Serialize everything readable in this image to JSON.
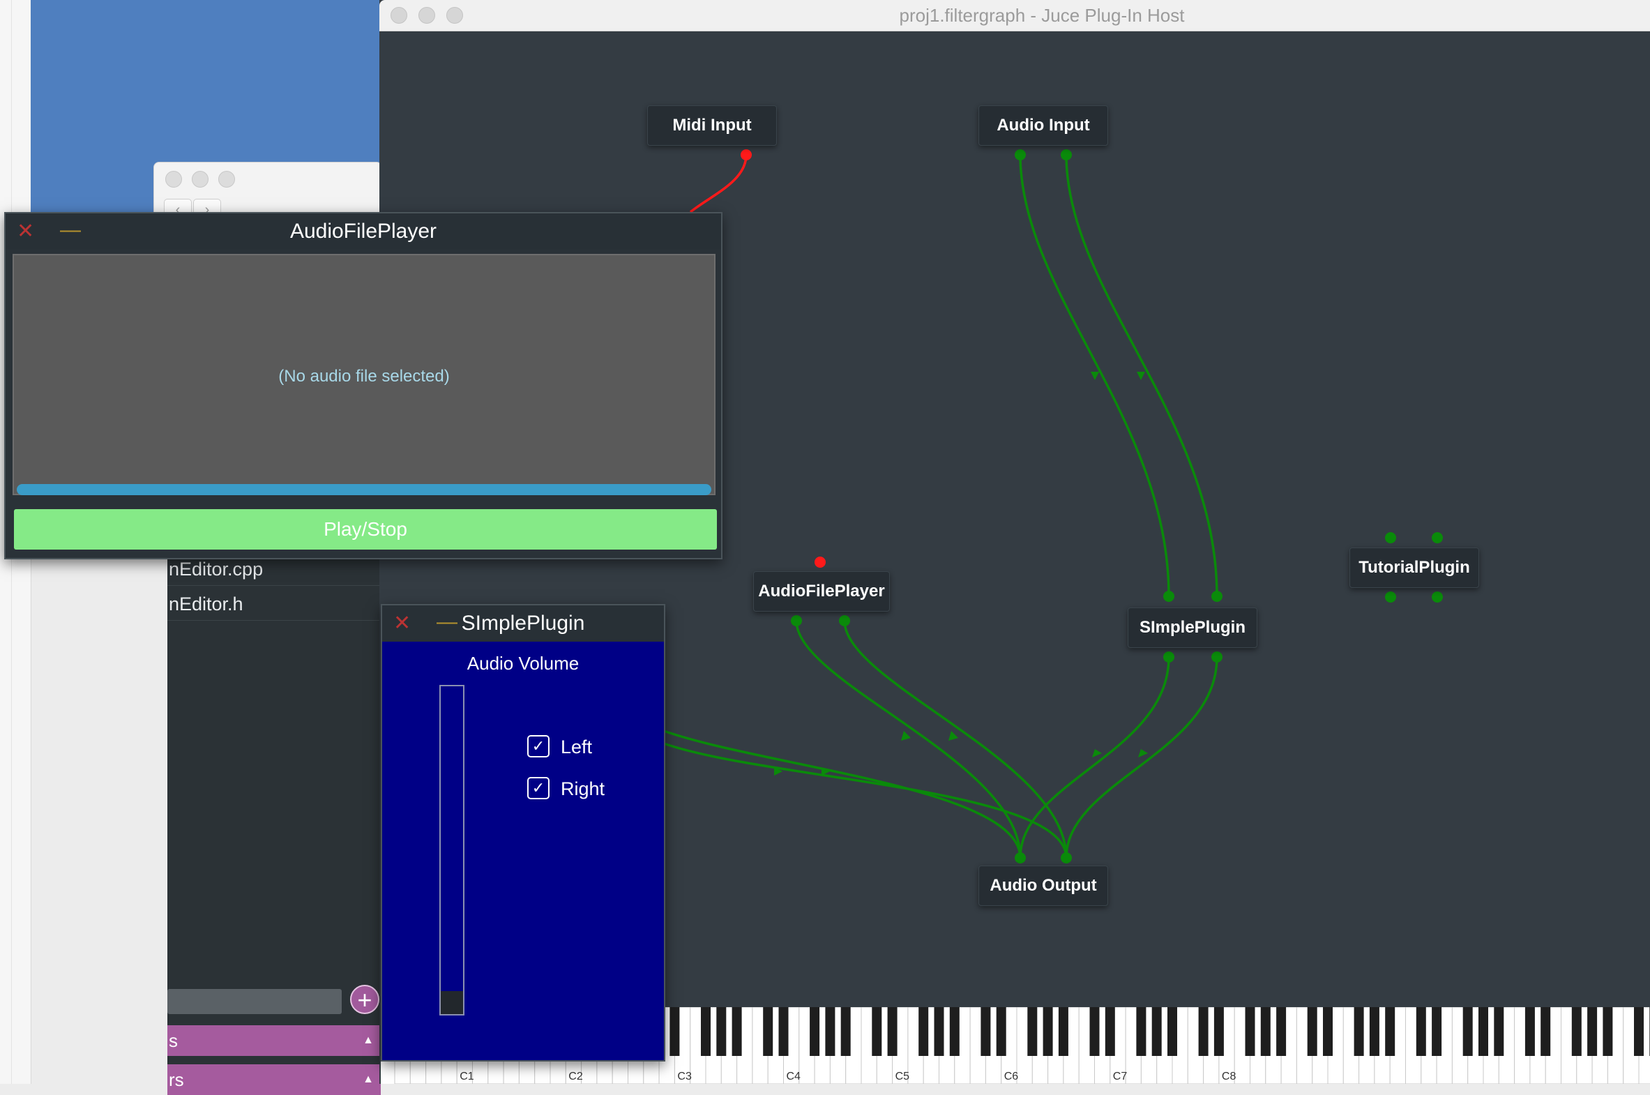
{
  "host_window": {
    "title": "proj1.filtergraph - Juce Plug-In Host"
  },
  "graph": {
    "nodes": {
      "midi_input": "Midi Input",
      "audio_input": "Audio Input",
      "audio_file_player": "AudioFilePlayer",
      "simple_plugin": "SImplePlugin",
      "tutorial_plugin": "TutorialPlugin",
      "audio_output": "Audio Output"
    },
    "colors": {
      "audio_connection": "#0a8a0a",
      "midi_connection": "#ff1a1a",
      "canvas": "#343c43"
    }
  },
  "audio_file_player_window": {
    "title": "AudioFilePlayer",
    "close_glyph": "✕",
    "minimise_glyph": "—",
    "status": "(No audio file selected)",
    "play_button": "Play/Stop"
  },
  "simple_plugin_window": {
    "title": "SImplePlugin",
    "close_glyph": "✕",
    "minimise_glyph": "—",
    "volume_label": "Audio Volume",
    "volume_level": 0.07,
    "left_checkbox": {
      "label": "Left",
      "checked": true
    },
    "right_checkbox": {
      "label": "Right",
      "checked": true
    },
    "check_glyph": "✓"
  },
  "project_panel": {
    "files": [
      "nEditor.cpp",
      "nEditor.h"
    ],
    "add_button": "+",
    "sections": [
      "s",
      "rs"
    ]
  },
  "keyboard": {
    "octave_labels": [
      "C1",
      "C2",
      "C3",
      "C4",
      "C5",
      "C6",
      "C7",
      "C8"
    ]
  }
}
